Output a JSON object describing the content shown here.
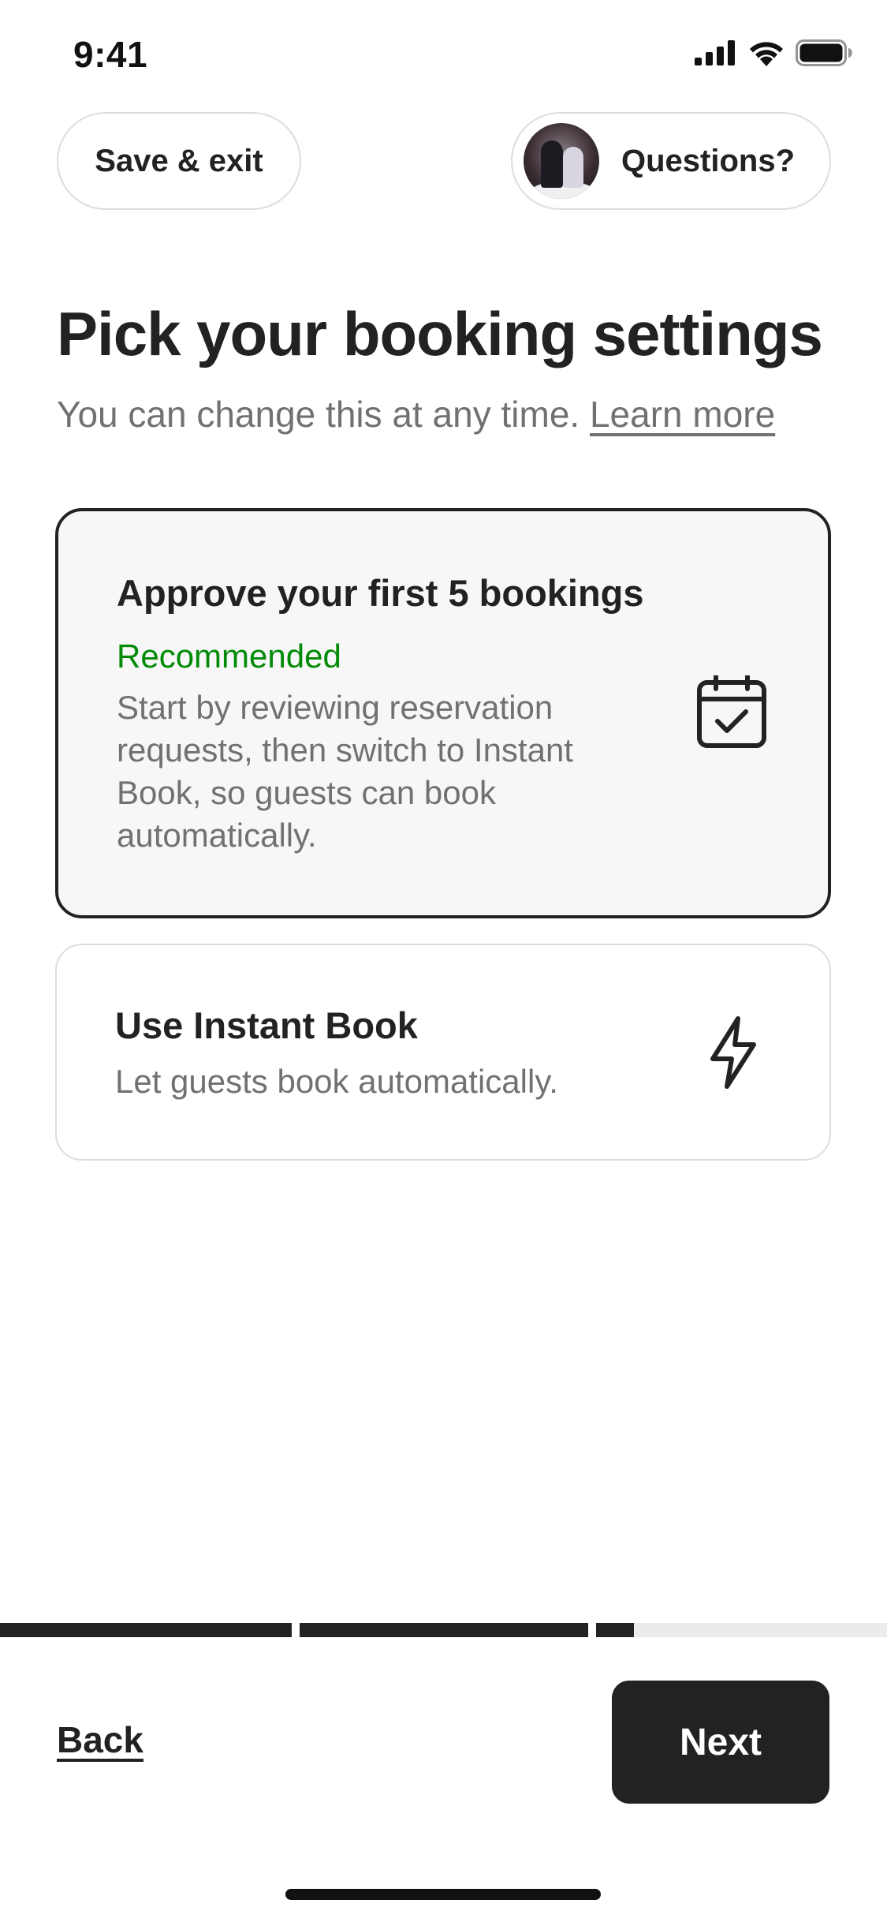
{
  "status_bar": {
    "time": "9:41",
    "icons": [
      "cellular-signal-icon",
      "wifi-icon",
      "battery-icon"
    ]
  },
  "header": {
    "save_exit_label": "Save & exit",
    "questions_label": "Questions?"
  },
  "main": {
    "title": "Pick your booking settings",
    "subtitle": "You can change this at any time.",
    "learn_more": "Learn more",
    "options": [
      {
        "title": "Approve your first 5 bookings",
        "badge": "Recommended",
        "description": "Start by reviewing reservation requests, then switch to Instant Book, so guests can book automatically.",
        "icon": "calendar-check-icon",
        "selected": true
      },
      {
        "title": "Use Instant Book",
        "description": "Let guests book automatically.",
        "icon": "lightning-bolt-icon",
        "selected": false
      }
    ]
  },
  "progress": {
    "segments": [
      1.0,
      1.0,
      0.13
    ]
  },
  "footer": {
    "back_label": "Back",
    "next_label": "Next"
  },
  "colors": {
    "text": "#222222",
    "secondary_text": "#717171",
    "recommended_green": "#008a05",
    "border": "#dddddd",
    "selected_card_bg": "#f7f7f7",
    "progress_track": "#ebebeb"
  }
}
